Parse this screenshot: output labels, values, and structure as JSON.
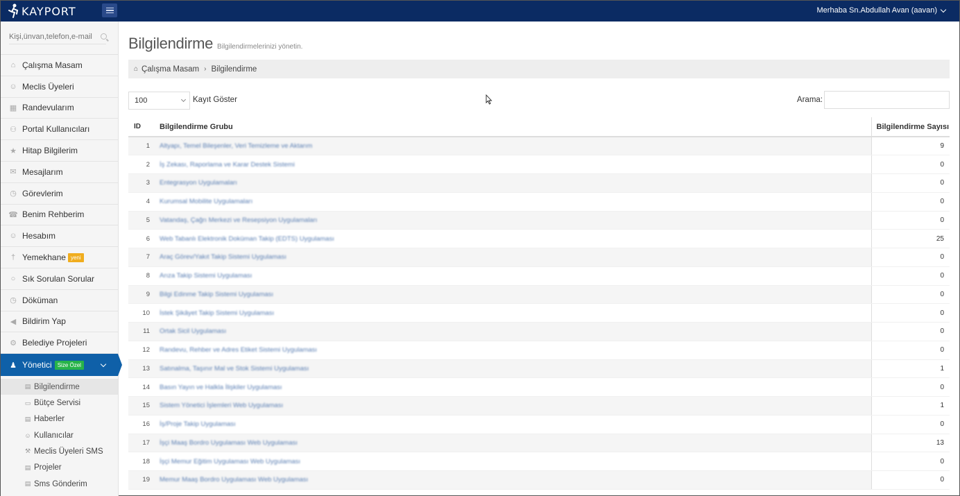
{
  "topbar": {
    "logo_text": "KAYPORT",
    "greeting": "Merhaba Sn.Abdullah Avan (aavan)"
  },
  "sidebar": {
    "search_placeholder": "Kişi,ünvan,telefon,e-mail",
    "items": [
      {
        "label": "Çalışma Masam",
        "icon": "home-icon"
      },
      {
        "label": "Meclis Üyeleri",
        "icon": "user-icon"
      },
      {
        "label": "Randevularım",
        "icon": "calendar-icon"
      },
      {
        "label": "Portal Kullanıcıları",
        "icon": "users-icon"
      },
      {
        "label": "Hitap Bilgilerim",
        "icon": "star-icon"
      },
      {
        "label": "Mesajlarım",
        "icon": "envelope-icon"
      },
      {
        "label": "Görevlerim",
        "icon": "clock-icon"
      },
      {
        "label": "Benim Rehberim",
        "icon": "phone-icon"
      },
      {
        "label": "Hesabım",
        "icon": "user-icon"
      },
      {
        "label": "Yemekhane",
        "icon": "cutlery-icon",
        "badge": "yeni"
      },
      {
        "label": "Sık Sorulan Sorular",
        "icon": "comment-icon"
      },
      {
        "label": "Döküman",
        "icon": "clock-icon"
      },
      {
        "label": "Bildirim Yap",
        "icon": "bullhorn-icon"
      },
      {
        "label": "Belediye Projeleri",
        "icon": "cogs-icon"
      }
    ],
    "active": {
      "label": "Yönetici",
      "badge": "Size Özel",
      "icon": "user-tie-icon"
    },
    "sub_items": [
      {
        "label": "Bilgilendirme",
        "icon": "building-icon"
      },
      {
        "label": "Bütçe Servisi",
        "icon": "money-icon"
      },
      {
        "label": "Haberler",
        "icon": "newspaper-icon"
      },
      {
        "label": "Kullanıcılar",
        "icon": "user-icon"
      },
      {
        "label": "Meclis Üyeleri SMS",
        "icon": "gavel-icon"
      },
      {
        "label": "Projeler",
        "icon": "building-icon"
      },
      {
        "label": "Sms Gönderim",
        "icon": "building-icon"
      }
    ]
  },
  "main": {
    "title": "Bilgilendirme",
    "subtitle": "Bilgilendirmelerinizi yönetin.",
    "breadcrumb": {
      "home": "Çalışma Masam",
      "current": "Bilgilendirme"
    },
    "length_value": "100",
    "length_label": "Kayıt Göster",
    "search_label": "Arama:",
    "table": {
      "headers": {
        "id": "ID",
        "group": "Bilgilendirme Grubu",
        "count": "Bilgilendirme Sayısı"
      },
      "rows": [
        {
          "id": "1",
          "group": "Altyapı, Temel Bileşenler, Veri Temizleme ve Aktarım",
          "count": "9"
        },
        {
          "id": "2",
          "group": "İş Zekası, Raporlama ve Karar Destek Sistemi",
          "count": "0"
        },
        {
          "id": "3",
          "group": "Entegrasyon Uygulamaları",
          "count": "0"
        },
        {
          "id": "4",
          "group": "Kurumsal Mobilite Uygulamaları",
          "count": "0"
        },
        {
          "id": "5",
          "group": "Vatandaş, Çağrı Merkezi ve Resepsiyon Uygulamaları",
          "count": "0"
        },
        {
          "id": "6",
          "group": "Web Tabanlı Elektronik Doküman Takip (EDTS) Uygulaması",
          "count": "25"
        },
        {
          "id": "7",
          "group": "Araç Görev/Yakıt Takip Sistemi Uygulaması",
          "count": "0"
        },
        {
          "id": "8",
          "group": "Arıza Takip Sistemi Uygulaması",
          "count": "0"
        },
        {
          "id": "9",
          "group": "Bilgi Edinme Takip Sistemi Uygulaması",
          "count": "0"
        },
        {
          "id": "10",
          "group": "İstek Şikâyet Takip Sistemi Uygulaması",
          "count": "0"
        },
        {
          "id": "11",
          "group": "Ortak Sicil Uygulaması",
          "count": "0"
        },
        {
          "id": "12",
          "group": "Randevu, Rehber ve Adres Etiket Sistemi Uygulaması",
          "count": "0"
        },
        {
          "id": "13",
          "group": "Satınalma, Taşınır Mal ve Stok Sistemi Uygulaması",
          "count": "1"
        },
        {
          "id": "14",
          "group": "Basın Yayın ve Halkla İlişkiler Uygulaması",
          "count": "0"
        },
        {
          "id": "15",
          "group": "Sistem Yönetici İşlemleri Web Uygulaması",
          "count": "1"
        },
        {
          "id": "16",
          "group": "İş/Proje Takip Uygulaması",
          "count": "0"
        },
        {
          "id": "17",
          "group": "İşçi Maaş Bordro Uygulaması Web Uygulaması",
          "count": "13"
        },
        {
          "id": "18",
          "group": "İşçi Memur Eğitim Uygulaması Web Uygulaması",
          "count": "0"
        },
        {
          "id": "19",
          "group": "Memur Maaş Bordro Uygulaması Web Uygulaması",
          "count": "0"
        }
      ]
    }
  }
}
